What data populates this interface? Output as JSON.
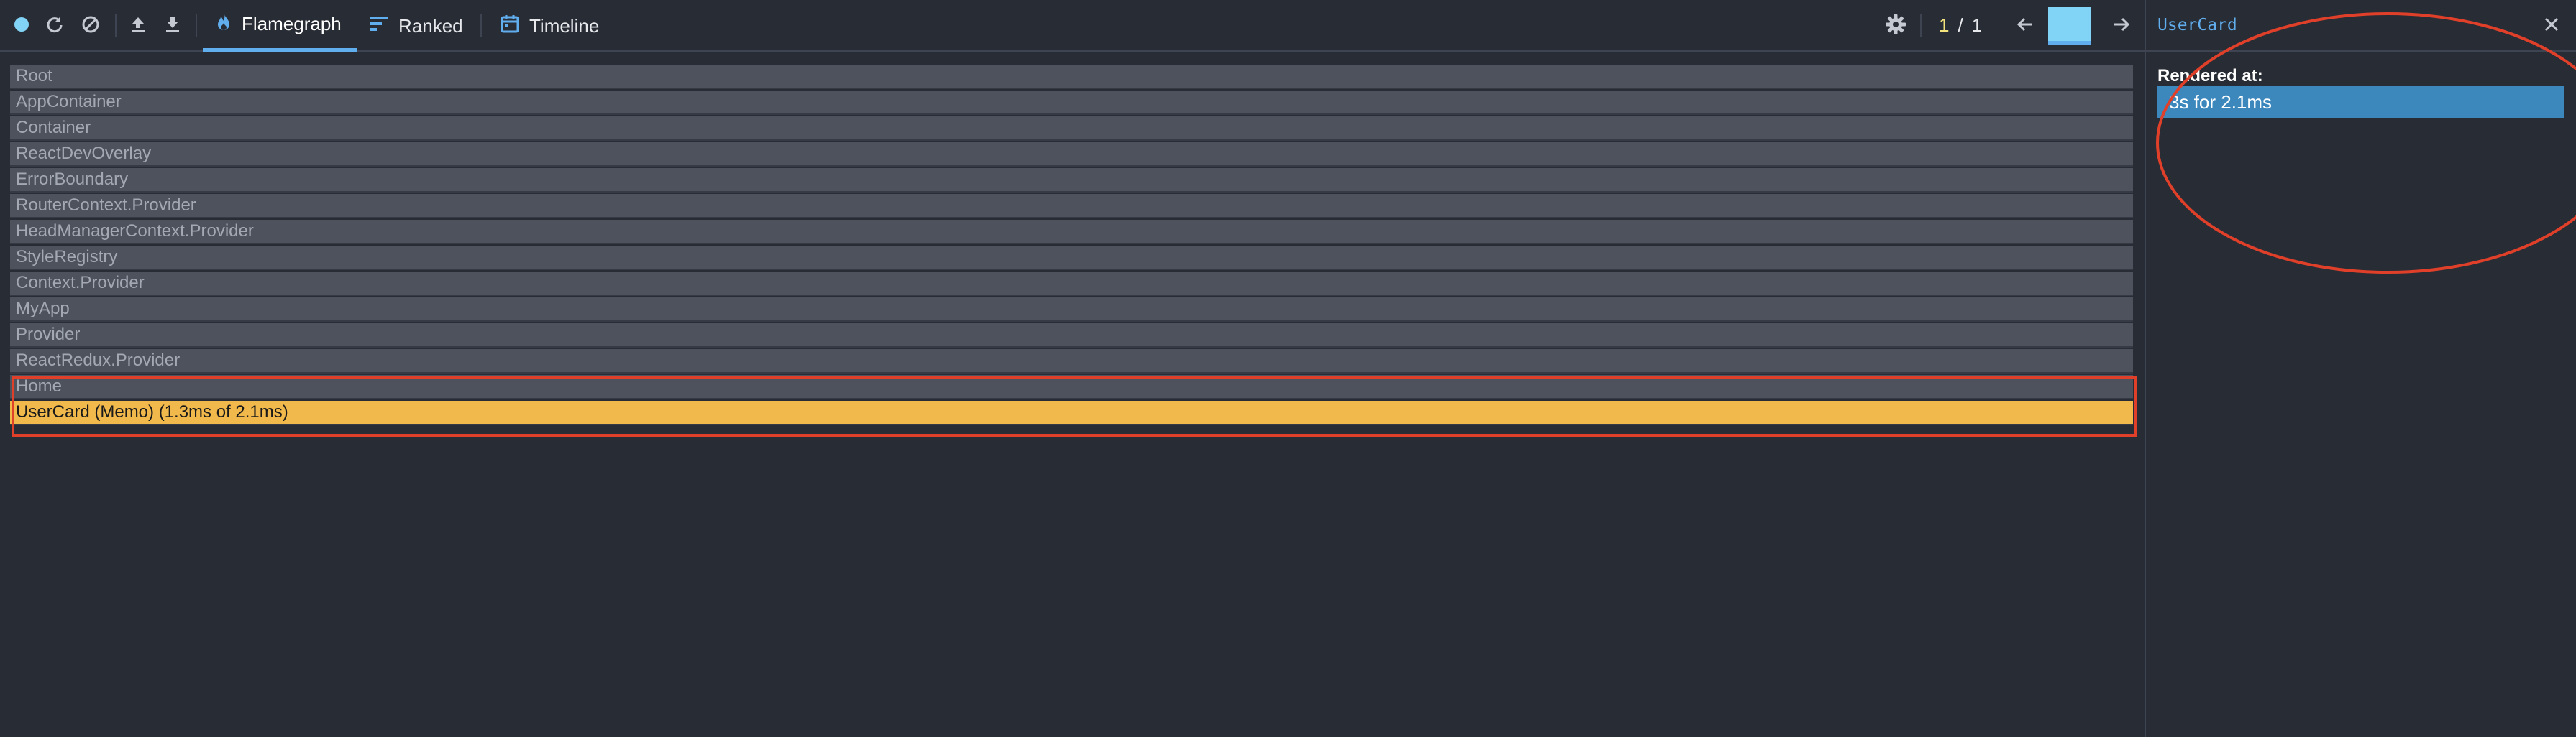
{
  "toolbar": {
    "record_icon": "record-icon",
    "reload_icon": "reload-icon",
    "clear_icon": "clear-icon",
    "load_icon": "load-profile-icon",
    "save_icon": "save-profile-icon",
    "tabs": [
      {
        "label": "Flamegraph",
        "icon": "flame-icon",
        "active": true
      },
      {
        "label": "Ranked",
        "icon": "ranked-icon",
        "active": false
      },
      {
        "label": "Timeline",
        "icon": "calendar-icon",
        "active": false
      }
    ],
    "settings_icon": "gear-icon",
    "commit_current": "1",
    "commit_separator": "/",
    "commit_total": "1",
    "prev_icon": "arrow-left-icon",
    "next_icon": "arrow-right-icon",
    "accent_color": "#61aeee",
    "commit_bar_color": "#82d4f7"
  },
  "flamegraph": {
    "rows": [
      {
        "label": "Root"
      },
      {
        "label": "AppContainer"
      },
      {
        "label": "Container"
      },
      {
        "label": "ReactDevOverlay"
      },
      {
        "label": "ErrorBoundary"
      },
      {
        "label": "RouterContext.Provider"
      },
      {
        "label": "HeadManagerContext.Provider"
      },
      {
        "label": "StyleRegistry"
      },
      {
        "label": "Context.Provider"
      },
      {
        "label": "MyApp"
      },
      {
        "label": "Provider"
      },
      {
        "label": "ReactRedux.Provider"
      },
      {
        "label": "Home"
      },
      {
        "label": "UserCard (Memo) (1.3ms of 2.1ms)",
        "selected": true
      }
    ],
    "inactive_color": "#4d525d",
    "selected_color": "#f1b84b"
  },
  "sidepanel": {
    "title": "UserCard",
    "close_icon": "close-icon",
    "rendered_at_label": "Rendered at:",
    "renders": [
      "3s for 2.1ms"
    ],
    "render_color": "#3c88bd"
  },
  "annotations": {
    "color": "#e0402a"
  }
}
